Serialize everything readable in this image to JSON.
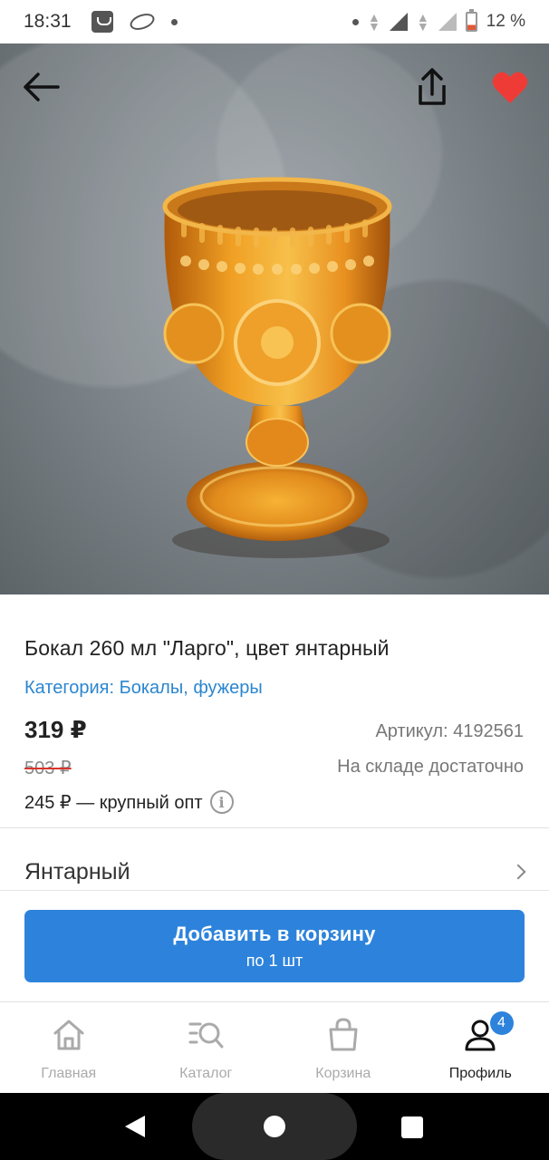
{
  "status_bar": {
    "time": "18:31",
    "battery_percent": "12 %",
    "icons": [
      "notification-icon",
      "app-icon",
      "dot-icon",
      "dot-icon",
      "data-arrows-icon",
      "signal-icon",
      "signal-icon",
      "battery-icon"
    ]
  },
  "hero": {
    "image": "amber-wine-glass-photo",
    "favorite": true,
    "colors": {
      "heart": "#ef3b36"
    }
  },
  "product": {
    "title": "Бокал 260 мл \"Ларго\", цвет янтарный",
    "category": "Категория: Бокалы, фужеры",
    "price": "319 ₽",
    "article": "Артикул: 4192561",
    "old_price": "503 ₽",
    "stock": "На складе достаточно",
    "wholesale": "245 ₽ — крупный опт"
  },
  "variant": {
    "label": "Янтарный"
  },
  "add_to_cart": {
    "label": "Добавить в корзину",
    "sublabel": "по 1 шт",
    "color": "#2d83dc"
  },
  "bottom_nav": {
    "items": [
      {
        "label": "Главная",
        "icon": "home-icon",
        "active": false
      },
      {
        "label": "Каталог",
        "icon": "catalog-search-icon",
        "active": false
      },
      {
        "label": "Корзина",
        "icon": "bag-icon",
        "active": false
      },
      {
        "label": "Профиль",
        "icon": "profile-icon",
        "active": true,
        "badge": "4"
      }
    ]
  }
}
